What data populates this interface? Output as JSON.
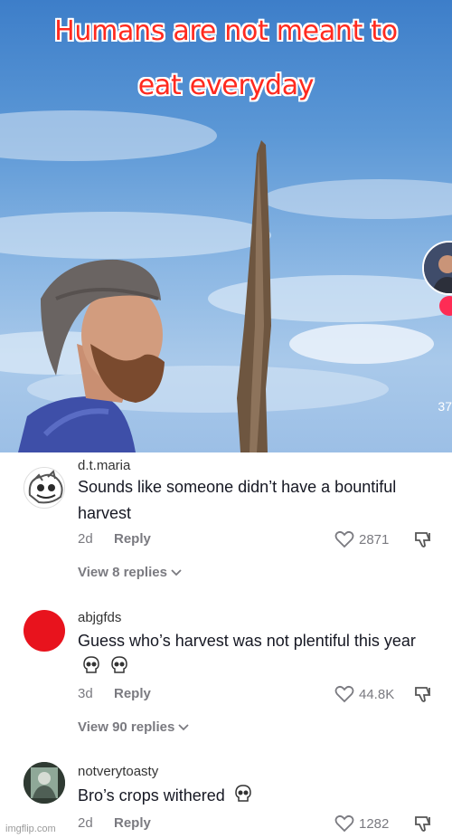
{
  "video": {
    "caption_line1": "Humans are not meant to",
    "caption_line2": "eat everyday",
    "side_count": "37"
  },
  "comments": [
    {
      "username": "d.t.maria",
      "text": "Sounds like someone didn’t have a bountiful harvest",
      "age": "2d",
      "reply_label": "Reply",
      "likes": "2871",
      "view_replies": "View 8 replies",
      "avatar": "cartoon-face-avatar"
    },
    {
      "username": "abjgfds",
      "text": "Guess who’s harvest was not plentiful this year",
      "emoji_count": 2,
      "age": "3d",
      "reply_label": "Reply",
      "likes": "44.8K",
      "view_replies": "View 90 replies",
      "avatar_color": "#e8131d"
    },
    {
      "username": "notverytoasty",
      "text": "Bro’s crops withered",
      "emoji_count": 1,
      "age": "2d",
      "reply_label": "Reply",
      "likes": "1282",
      "avatar": "photo-avatar"
    }
  ],
  "watermark": "imgflip.com",
  "colors": {
    "caption": "#ff2a1f",
    "text": "#161823",
    "muted": "#7a7a80",
    "avatar_red": "#e8131d"
  }
}
